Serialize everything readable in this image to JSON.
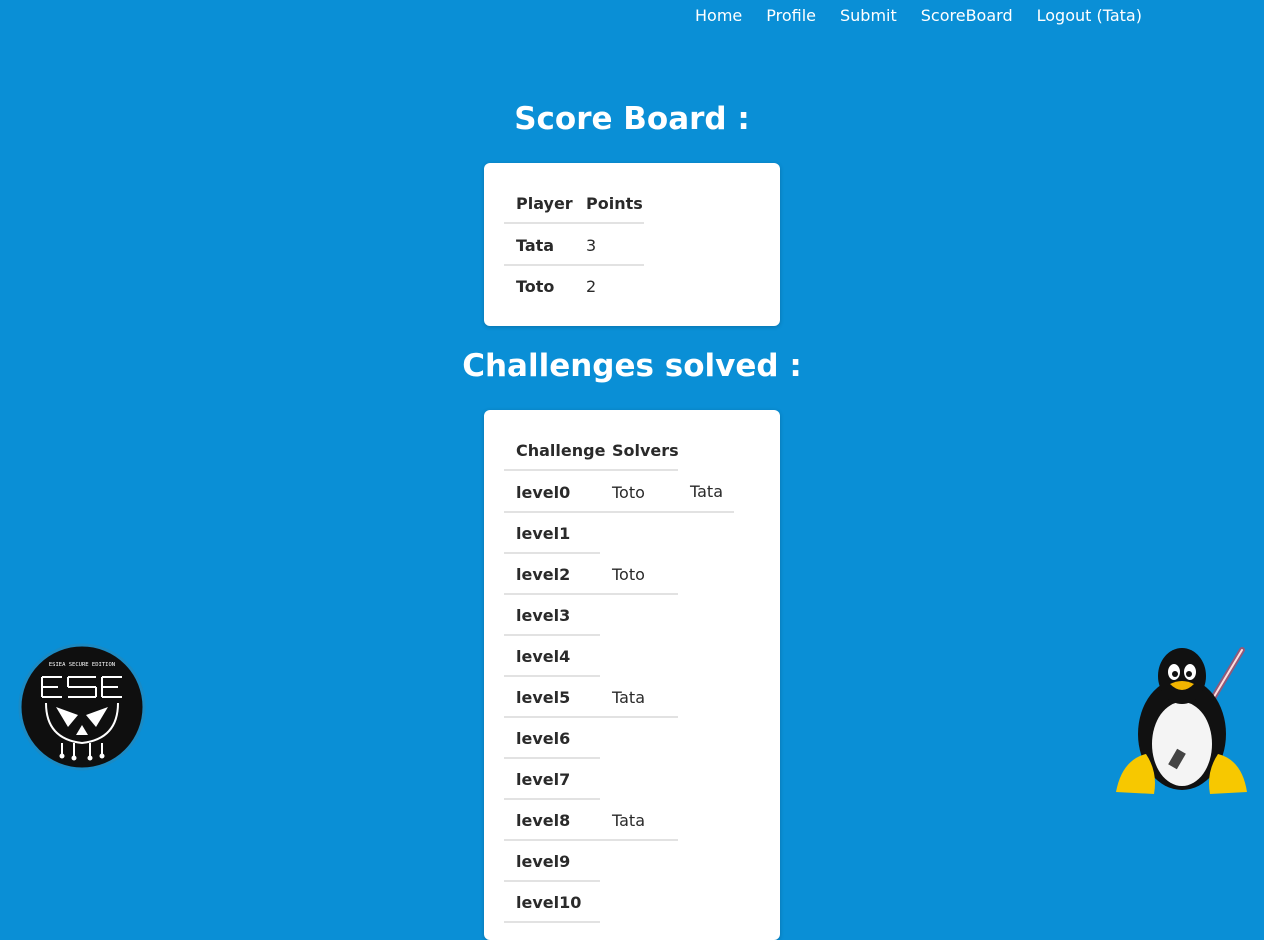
{
  "nav": {
    "home": "Home",
    "profile": "Profile",
    "submit": "Submit",
    "scoreboard": "ScoreBoard",
    "logout": "Logout (Tata)"
  },
  "scoreboard": {
    "title": "Score Board :",
    "headers": {
      "player": "Player",
      "points": "Points"
    },
    "rows": [
      {
        "player": "Tata",
        "points": "3"
      },
      {
        "player": "Toto",
        "points": "2"
      }
    ]
  },
  "challenges": {
    "title": "Challenges solved :",
    "headers": {
      "challenge": "Challenge",
      "solvers": "Solvers"
    },
    "rows": [
      {
        "name": "level0",
        "solvers": [
          "Toto",
          "Tata"
        ]
      },
      {
        "name": "level1",
        "solvers": []
      },
      {
        "name": "level2",
        "solvers": [
          "Toto"
        ]
      },
      {
        "name": "level3",
        "solvers": []
      },
      {
        "name": "level4",
        "solvers": []
      },
      {
        "name": "level5",
        "solvers": [
          "Tata"
        ]
      },
      {
        "name": "level6",
        "solvers": []
      },
      {
        "name": "level7",
        "solvers": []
      },
      {
        "name": "level8",
        "solvers": [
          "Tata"
        ]
      },
      {
        "name": "level9",
        "solvers": []
      },
      {
        "name": "level10",
        "solvers": []
      }
    ]
  },
  "logo": {
    "text": "ESIEA SECURE EDITION"
  },
  "colors": {
    "background": "#0a8fd6",
    "card": "#ffffff",
    "text": "#2a2a2a"
  }
}
